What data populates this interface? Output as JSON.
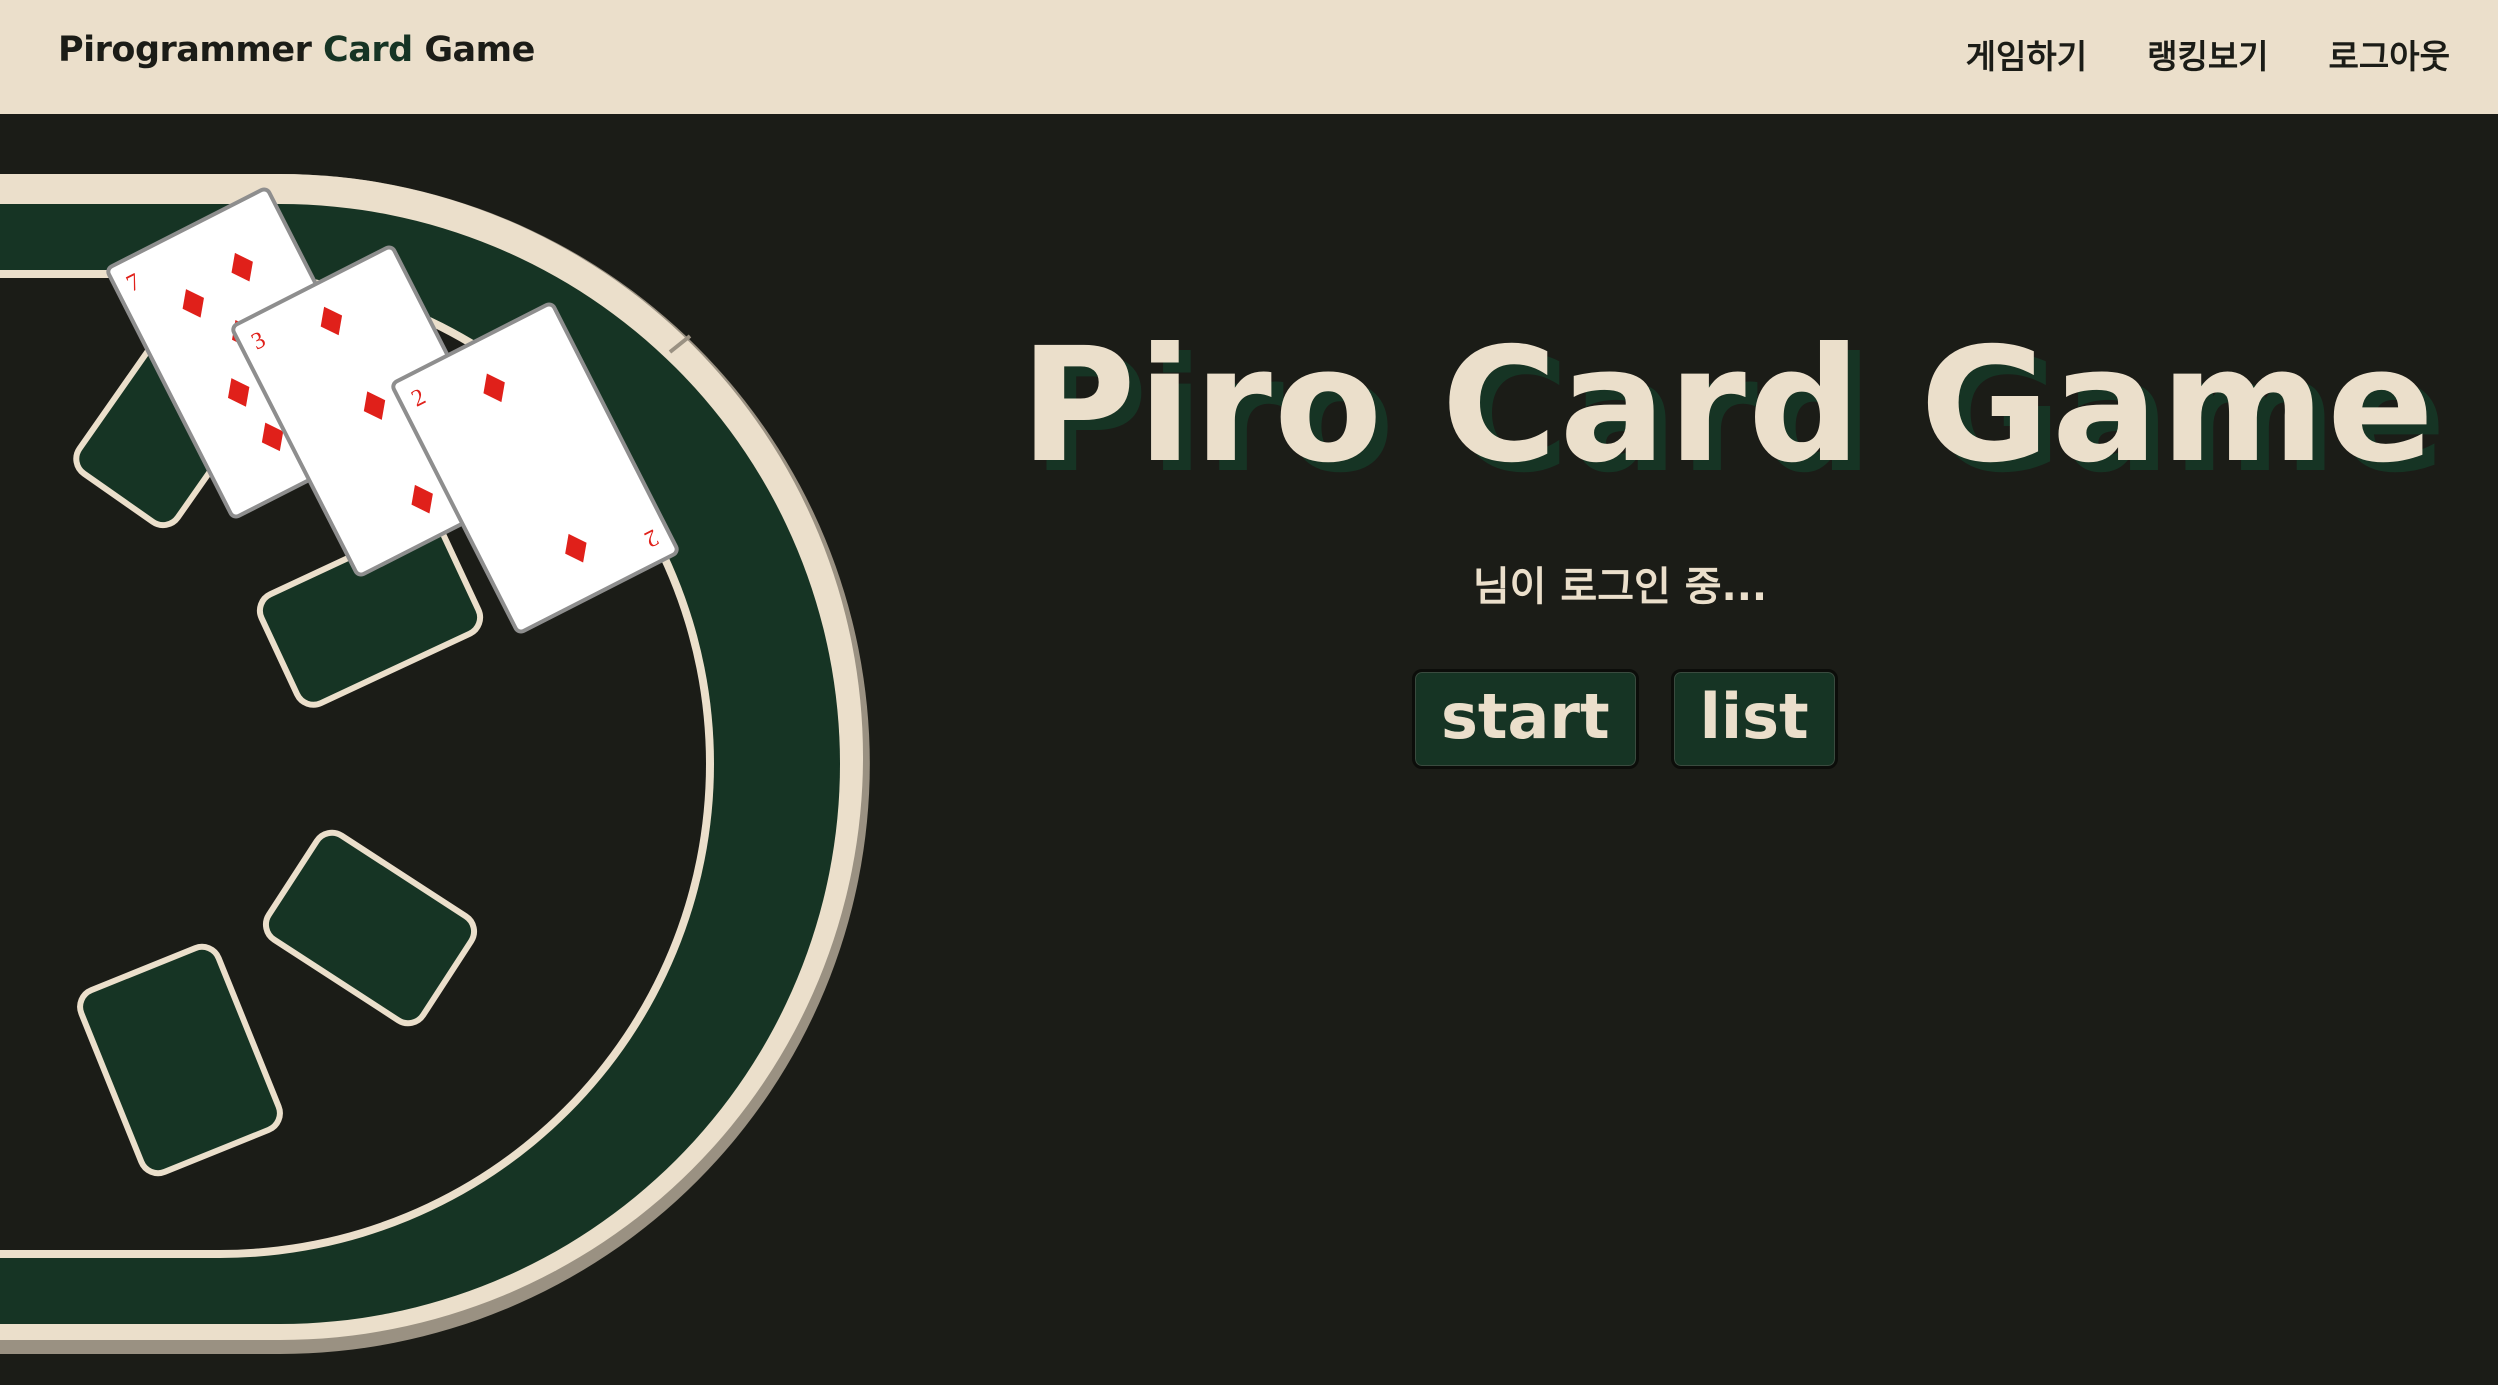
{
  "navbar": {
    "brand_prefix": "Pirogrammer ",
    "brand_accent": "Card",
    "brand_suffix": " Game",
    "links": [
      "게임하기",
      "랭킹보기",
      "로그아웃"
    ]
  },
  "hero": {
    "title": "Piro Card Game",
    "login_status": "님이 로그인 중...",
    "start_label": "start",
    "list_label": "list"
  },
  "cards": [
    {
      "rank": "7",
      "suit": "diamonds"
    },
    {
      "rank": "3",
      "suit": "diamonds"
    },
    {
      "rank": "2",
      "suit": "diamonds"
    }
  ],
  "colors": {
    "background": "#1b1c17",
    "cream": "#ebdfcb",
    "felt_green": "#163424",
    "rail_gray": "#9a9182",
    "suit_red": "#e0201a"
  }
}
